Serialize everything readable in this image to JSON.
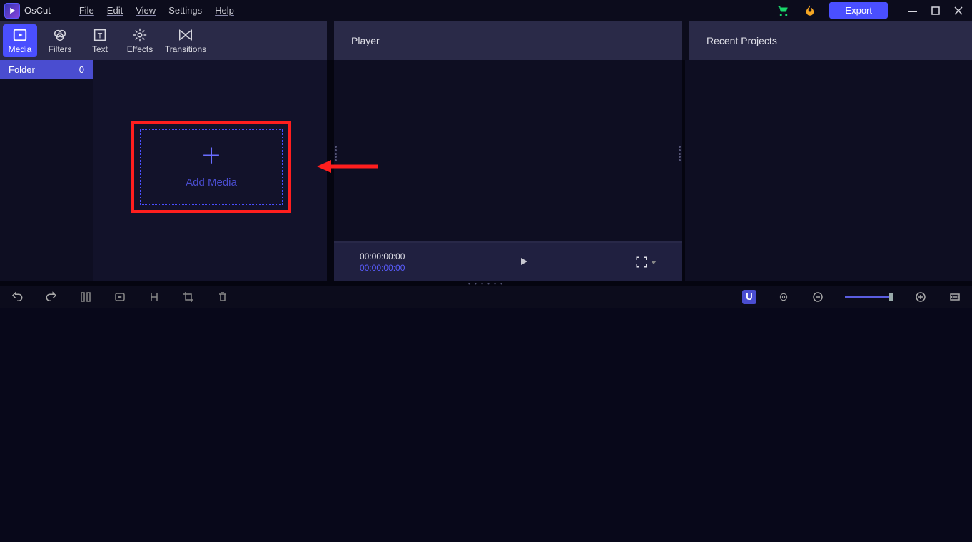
{
  "app": {
    "title": "OsCut"
  },
  "menu": {
    "file": "File",
    "edit": "Edit",
    "view": "View",
    "settings": "Settings",
    "help": "Help"
  },
  "titlebar": {
    "export": "Export"
  },
  "tooltabs": {
    "media": "Media",
    "filters": "Filters",
    "text": "Text",
    "effects": "Effects",
    "transitions": "Transitions"
  },
  "panels": {
    "player": "Player",
    "recent": "Recent Projects"
  },
  "folder": {
    "label": "Folder",
    "count": "0"
  },
  "media": {
    "add_label": "Add Media"
  },
  "player": {
    "tc1": "00:00:00:00",
    "tc2": "00:00:00:00"
  },
  "timeline": {
    "magnet_label": "U"
  }
}
